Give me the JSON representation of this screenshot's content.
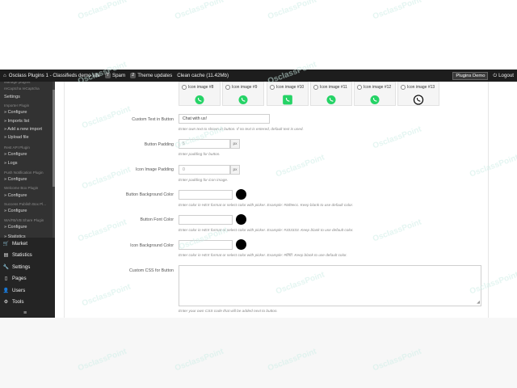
{
  "topbar": {
    "site_title": "Osclass Plugins 1 - Classifieds demo site",
    "spam_count": "7",
    "spam_label": "Spam",
    "theme_updates_count": "2",
    "theme_updates_label": "Theme updates",
    "clean_cache": "Clean cache (11.42Mb)",
    "plugins_demo": "Plugins Demo",
    "logout": "Logout"
  },
  "sidebar": {
    "submenu": [
      {
        "type": "head",
        "text": "Manage plugins"
      },
      {
        "type": "head",
        "text": "reCaptcha reCaptcha"
      },
      {
        "type": "link",
        "text": "Settings"
      },
      {
        "type": "head",
        "text": "Importer Plugin"
      },
      {
        "type": "link",
        "text": "» Configure"
      },
      {
        "type": "link",
        "text": "» Imports list"
      },
      {
        "type": "link",
        "text": "» Add a new import"
      },
      {
        "type": "link",
        "text": "» Upload file"
      },
      {
        "type": "head",
        "text": "Rest API Plugin"
      },
      {
        "type": "link",
        "text": "» Configure"
      },
      {
        "type": "link",
        "text": "» Logs"
      },
      {
        "type": "head",
        "text": "Push Notification Plugin"
      },
      {
        "type": "link",
        "text": "» Configure"
      },
      {
        "type": "head",
        "text": "Welcome Box Plugin"
      },
      {
        "type": "link",
        "text": "» Configure"
      },
      {
        "type": "head",
        "text": "Success Publish Box Pl..."
      },
      {
        "type": "link",
        "text": "» Configure"
      },
      {
        "type": "head",
        "text": "WA/FB/VB Share Plugin"
      },
      {
        "type": "link",
        "text": "» Configure"
      },
      {
        "type": "link",
        "text": "» Statistics"
      }
    ],
    "nav": [
      {
        "label": "Market",
        "icon": "cart-icon"
      },
      {
        "label": "Statistics",
        "icon": "chart-icon"
      },
      {
        "label": "Settings",
        "icon": "wrench-icon"
      },
      {
        "label": "Pages",
        "icon": "page-icon"
      },
      {
        "label": "Users",
        "icon": "user-icon"
      },
      {
        "label": "Tools",
        "icon": "tools-icon"
      }
    ],
    "collapse": "≡"
  },
  "icon_options": [
    {
      "label": "Icon image #8",
      "style": "whatsapp-green-bubble"
    },
    {
      "label": "Icon image #9",
      "style": "whatsapp-green-flat"
    },
    {
      "label": "Icon image #10",
      "style": "whatsapp-green-square"
    },
    {
      "label": "Icon image #11",
      "style": "whatsapp-green-circle"
    },
    {
      "label": "Icon image #12",
      "style": "whatsapp-green-outline"
    },
    {
      "label": "Icon image #13",
      "style": "whatsapp-black"
    }
  ],
  "form": {
    "custom_text": {
      "label": "Custom Text in Button",
      "value": "Chat with us!",
      "help": "Enter own text to shown in button. If no text is entered, default text is used."
    },
    "button_padding": {
      "label": "Button Padding",
      "value": "5",
      "unit": "px",
      "help": "Enter padding for button."
    },
    "icon_padding": {
      "label": "Icon Image Padding",
      "value": "0",
      "unit": "px",
      "help": "Enter padding for icon image."
    },
    "bg_color": {
      "label": "Button Background Color",
      "value": "",
      "help": "Enter color in HEX format or select color with picker. Example: #0d9ecc. Keep blank to use default color."
    },
    "font_color": {
      "label": "Button Font Color",
      "value": "",
      "help": "Enter color in HEX format or select color with picker. Example: #333333. Keep blank to use default color."
    },
    "icon_bg_color": {
      "label": "Icon Background Color",
      "value": "",
      "help": "Enter color in HEX format or select color with picker. Example: #ffffff. Keep blank to use default color."
    },
    "custom_css": {
      "label": "Custom CSS for Button",
      "value": "",
      "help": "Enter your own CSS code that will be added next to button."
    }
  },
  "watermark": "OsclassPoint",
  "colors": {
    "whatsapp": "#25d366",
    "swatch": "#000000",
    "topbar": "#1d1d1d",
    "sidebar": "#242424"
  }
}
